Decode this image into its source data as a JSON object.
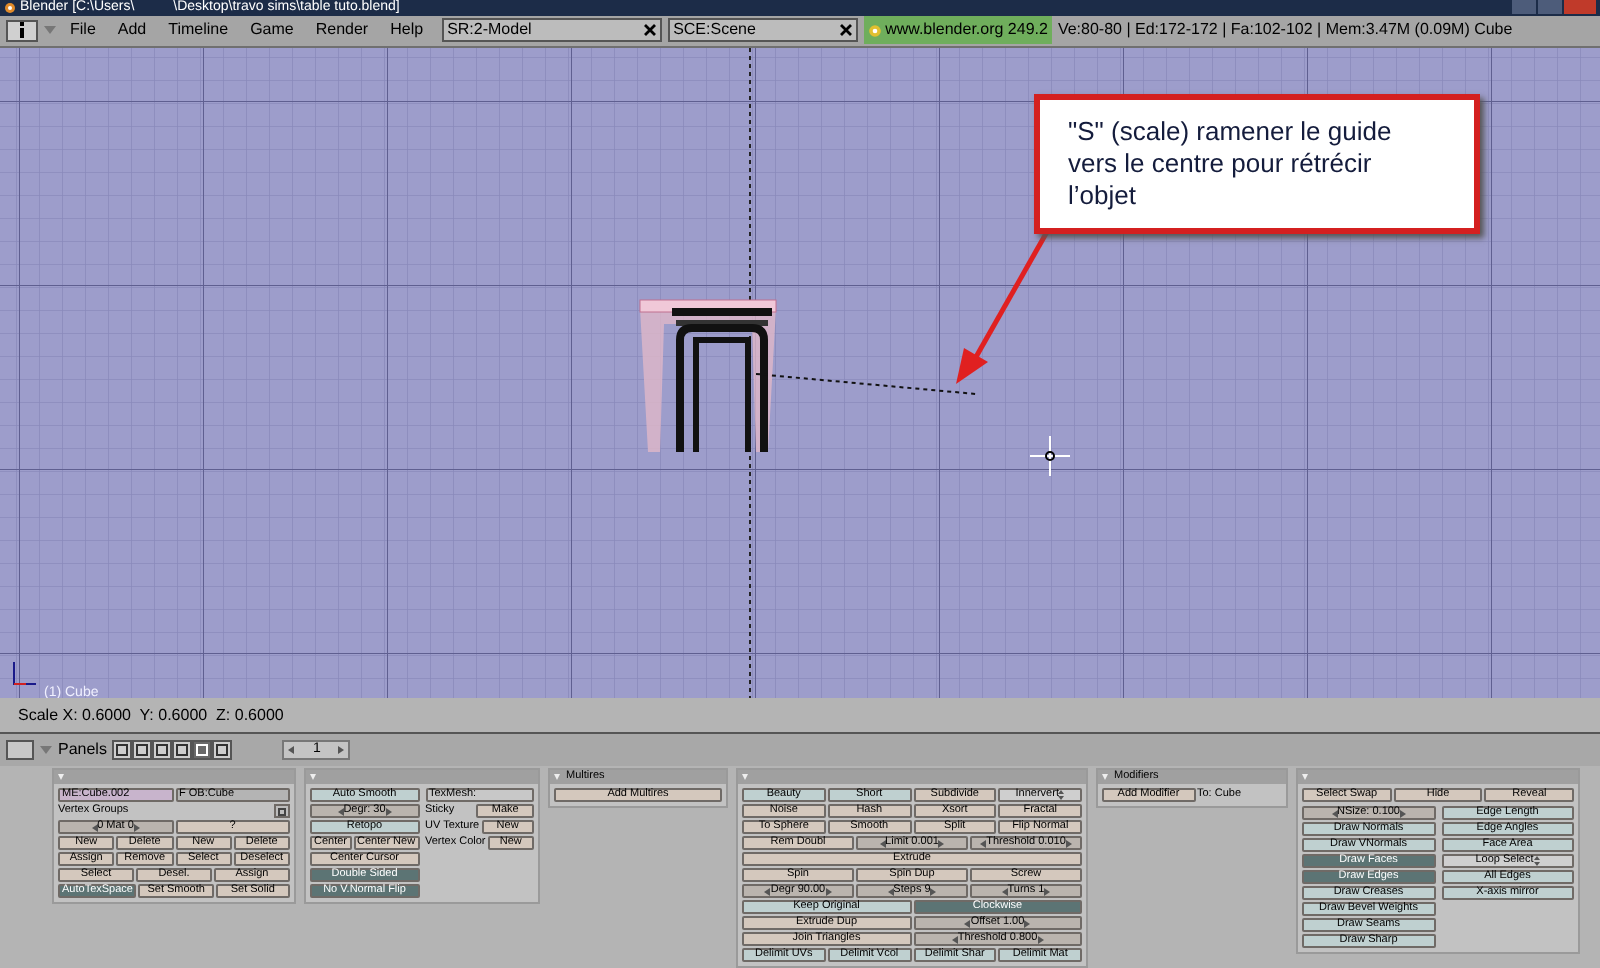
{
  "window": {
    "title": "Blender [C:\\Users\\          \\Desktop\\travo sims\\table tuto.blend]"
  },
  "menu_bar": {
    "menus": [
      "File",
      "Add",
      "Timeline",
      "Game",
      "Render",
      "Help"
    ],
    "screen": "SR:2-Model",
    "scene": "SCE:Scene",
    "version": "www.blender.org 249.2",
    "stats": "Ve:80-80 | Ed:172-172 | Fa:102-102 | Mem:3.47M (0.09M) Cube"
  },
  "viewport": {
    "object_label": "(1) Cube",
    "annotation": "\"S\" (scale) ramener le guide vers le centre pour rétrécir l’objet"
  },
  "status": {
    "scale": "Scale X: 0.6000  Y: 0.6000  Z: 0.6000"
  },
  "buttons_header": {
    "label": "Panels",
    "tabs": [
      {
        "selected": false
      },
      {
        "selected": false
      },
      {
        "selected": false
      },
      {
        "selected": false
      },
      {
        "selected": true
      },
      {
        "selected": false
      }
    ],
    "frame": "1"
  },
  "panels": [
    {
      "columns": [
        [
          [
            {
              "kind": "field",
              "label": "ME:Cube.002",
              "color": "#c8b4cc"
            },
            {
              "kind": "field",
              "label": "F OB:Cube",
              "color": "#b4b4b4"
            }
          ],
          [
            {
              "kind": "label",
              "label": "Vertex Groups"
            },
            {
              "kind": "icon"
            }
          ],
          [
            {
              "kind": "num",
              "label": "0 Mat 0"
            },
            {
              "kind": "button",
              "label": "?"
            }
          ],
          [
            {
              "kind": "button",
              "label": "New"
            },
            {
              "kind": "button",
              "label": "Delete"
            },
            {
              "kind": "button",
              "label": "New"
            },
            {
              "kind": "button",
              "label": "Delete"
            }
          ],
          [
            {
              "kind": "button",
              "label": "Assign"
            },
            {
              "kind": "button",
              "label": "Remove"
            },
            {
              "kind": "button",
              "label": "Select"
            },
            {
              "kind": "button",
              "label": "Deselect"
            }
          ],
          [
            {
              "kind": "button",
              "label": "Select"
            },
            {
              "kind": "button",
              "label": "Desel."
            },
            {
              "kind": "button",
              "label": "Assign"
            }
          ],
          [
            {
              "kind": "toggle",
              "label": "AutoTexSpace",
              "on": true
            },
            {
              "kind": "button",
              "label": "Set Smooth"
            },
            {
              "kind": "button",
              "label": "Set Solid"
            }
          ]
        ]
      ]
    },
    {
      "columns": [
        [
          [
            {
              "kind": "toggle",
              "label": "Auto Smooth",
              "on": false
            }
          ],
          [
            {
              "kind": "num",
              "label": "Degr: 30"
            }
          ],
          [
            {
              "kind": "toggle",
              "label": "Retopo",
              "on": false
            }
          ],
          [
            {
              "kind": "button",
              "label": "Center"
            },
            {
              "kind": "button",
              "label": "Center New"
            }
          ],
          [
            {
              "kind": "button",
              "label": "Center Cursor"
            }
          ],
          [
            {
              "kind": "toggle",
              "label": "Double Sided",
              "on": true
            }
          ],
          [
            {
              "kind": "toggle",
              "label": "No V.Normal Flip",
              "on": true
            }
          ]
        ],
        [
          [
            {
              "kind": "field",
              "label": "TexMesh:",
              "color": "#c8c8c8"
            }
          ],
          [
            {
              "kind": "label",
              "label": "Sticky"
            },
            {
              "kind": "button",
              "label": "Make"
            }
          ],
          [
            {
              "kind": "label",
              "label": "UV Texture"
            },
            {
              "kind": "button",
              "label": "New"
            }
          ],
          [
            {
              "kind": "label",
              "label": "Vertex Color"
            },
            {
              "kind": "button",
              "label": "New"
            }
          ]
        ]
      ]
    },
    {
      "title": "Multires",
      "columns": [
        [
          [
            {
              "kind": "button",
              "label": "Add Multires"
            }
          ]
        ]
      ]
    },
    {
      "columns": [
        [
          [
            {
              "kind": "toggle",
              "label": "Beauty",
              "on": false
            },
            {
              "kind": "toggle",
              "label": "Short",
              "on": false
            },
            {
              "kind": "button",
              "label": "Subdivide"
            },
            {
              "kind": "menu",
              "label": "Innervert"
            }
          ],
          [
            {
              "kind": "button",
              "label": "Noise"
            },
            {
              "kind": "button",
              "label": "Hash"
            },
            {
              "kind": "button",
              "label": "Xsort"
            },
            {
              "kind": "button",
              "label": "Fractal"
            }
          ],
          [
            {
              "kind": "button",
              "label": "To Sphere"
            },
            {
              "kind": "button",
              "label": "Smooth"
            },
            {
              "kind": "button",
              "label": "Split"
            },
            {
              "kind": "button",
              "label": "Flip Normal"
            }
          ],
          [
            {
              "kind": "button",
              "label": "Rem Doubl"
            },
            {
              "kind": "num",
              "label": "Limit 0.001"
            },
            {
              "kind": "num",
              "label": "Threshold 0.010"
            }
          ],
          [
            {
              "kind": "button",
              "label": "Extrude"
            }
          ],
          [
            {
              "kind": "button",
              "label": "Spin"
            },
            {
              "kind": "button",
              "label": "Spin Dup"
            },
            {
              "kind": "button",
              "label": "Screw"
            }
          ],
          [
            {
              "kind": "num",
              "label": "Degr 90.00"
            },
            {
              "kind": "num",
              "label": "Steps 9"
            },
            {
              "kind": "num",
              "label": "Turns 1"
            }
          ],
          [
            {
              "kind": "toggle",
              "label": "Keep Original",
              "on": false
            },
            {
              "kind": "toggle",
              "label": "Clockwise",
              "on": true
            }
          ],
          [
            {
              "kind": "button",
              "label": "Extrude Dup"
            },
            {
              "kind": "num",
              "label": "Offset 1.00"
            }
          ],
          [
            {
              "kind": "button",
              "label": "Join Triangles"
            },
            {
              "kind": "num",
              "label": "Threshold 0.800"
            }
          ],
          [
            {
              "kind": "toggle",
              "label": "Delimit UVs",
              "on": false
            },
            {
              "kind": "toggle",
              "label": "Delimit Vcol",
              "on": false
            },
            {
              "kind": "toggle",
              "label": "Delimit Shar",
              "on": false
            },
            {
              "kind": "toggle",
              "label": "Delimit Mat",
              "on": false
            }
          ]
        ]
      ]
    },
    {
      "title": "Modifiers",
      "columns": [
        [
          [
            {
              "kind": "button",
              "label": "Add Modifier"
            },
            {
              "kind": "label",
              "label": "To: Cube"
            }
          ]
        ]
      ]
    },
    {
      "top": [
        [
          {
            "kind": "button",
            "label": "Select Swap"
          },
          {
            "kind": "button",
            "label": "Hide"
          },
          {
            "kind": "button",
            "label": "Reveal"
          }
        ]
      ],
      "columns": [
        [
          [
            {
              "kind": "num",
              "label": "NSize: 0.100"
            }
          ],
          [
            {
              "kind": "toggle",
              "label": "Draw Normals",
              "on": false
            }
          ],
          [
            {
              "kind": "toggle",
              "label": "Draw VNormals",
              "on": false
            }
          ],
          [
            {
              "kind": "toggle",
              "label": "Draw Faces",
              "on": true
            }
          ],
          [
            {
              "kind": "toggle",
              "label": "Draw Edges",
              "on": true
            }
          ],
          [
            {
              "kind": "toggle",
              "label": "Draw Creases",
              "on": false
            }
          ],
          [
            {
              "kind": "toggle",
              "label": "Draw Bevel Weights",
              "on": false
            }
          ],
          [
            {
              "kind": "toggle",
              "label": "Draw Seams",
              "on": false
            }
          ],
          [
            {
              "kind": "toggle",
              "label": "Draw Sharp",
              "on": false
            }
          ]
        ],
        [
          [
            {
              "kind": "toggle",
              "label": "Edge Length",
              "on": false
            }
          ],
          [
            {
              "kind": "toggle",
              "label": "Edge Angles",
              "on": false
            }
          ],
          [
            {
              "kind": "toggle",
              "label": "Face Area",
              "on": false
            }
          ],
          [
            {
              "kind": "menu",
              "label": "Loop Select"
            }
          ],
          [
            {
              "kind": "toggle",
              "label": "All Edges",
              "on": false
            }
          ],
          [
            {
              "kind": "toggle",
              "label": "X-axis mirror",
              "on": false
            }
          ]
        ]
      ]
    }
  ]
}
